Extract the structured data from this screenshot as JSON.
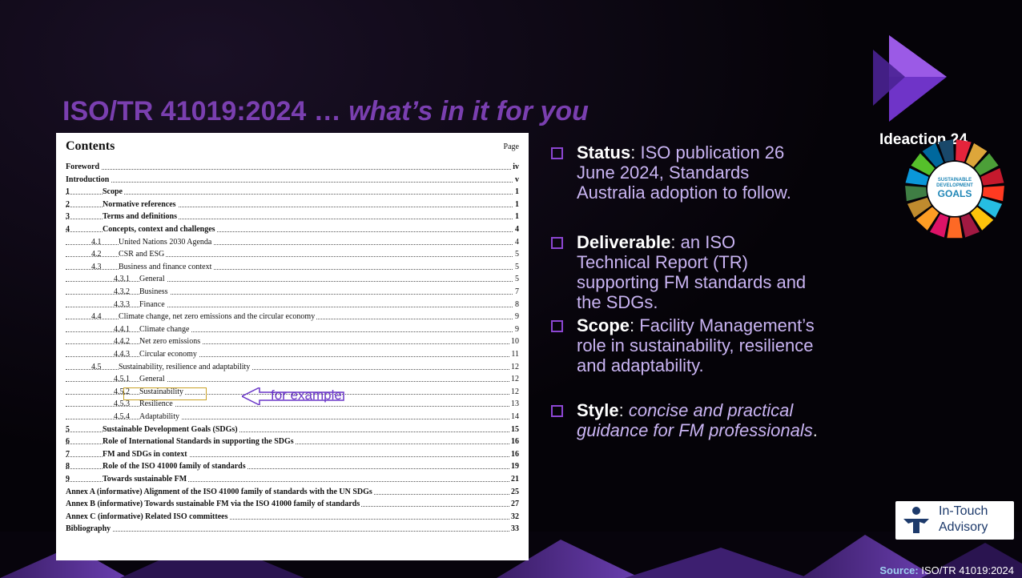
{
  "slide": {
    "title_main": "ISO/TR 41019:2024 … ",
    "title_sub": "what’s in it for you",
    "brand": "Ideaction.24"
  },
  "contents": {
    "title": "Contents",
    "page_header": "Page",
    "entries": [
      {
        "num": "",
        "label": "Foreword",
        "page": "iv",
        "bold": true,
        "level": 0
      },
      {
        "num": "",
        "label": "Introduction",
        "page": "v",
        "bold": true,
        "level": 0
      },
      {
        "num": "1",
        "label": "Scope",
        "page": "1",
        "bold": true,
        "level": 0
      },
      {
        "num": "2",
        "label": "Normative references",
        "page": "1",
        "bold": true,
        "level": 0
      },
      {
        "num": "3",
        "label": "Terms and definitions",
        "page": "1",
        "bold": true,
        "level": 0
      },
      {
        "num": "4",
        "label": "Concepts, context and challenges",
        "page": "4",
        "bold": true,
        "level": 0
      },
      {
        "num": "4.1",
        "label": "United Nations 2030 Agenda",
        "page": "4",
        "bold": false,
        "level": 1
      },
      {
        "num": "4.2",
        "label": "CSR and ESG",
        "page": "5",
        "bold": false,
        "level": 1
      },
      {
        "num": "4.3",
        "label": "Business and finance context",
        "page": "5",
        "bold": false,
        "level": 1
      },
      {
        "num": "4.3.1",
        "label": "General",
        "page": "5",
        "bold": false,
        "level": 2
      },
      {
        "num": "4.3.2",
        "label": "Business",
        "page": "7",
        "bold": false,
        "level": 2
      },
      {
        "num": "4.3.3",
        "label": "Finance",
        "page": "8",
        "bold": false,
        "level": 2
      },
      {
        "num": "4.4",
        "label": "Climate change, net zero emissions and the circular economy",
        "page": "9",
        "bold": false,
        "level": 1
      },
      {
        "num": "4.4.1",
        "label": "Climate change",
        "page": "9",
        "bold": false,
        "level": 2
      },
      {
        "num": "4.4.2",
        "label": "Net zero emissions",
        "page": "10",
        "bold": false,
        "level": 2
      },
      {
        "num": "4.4.3",
        "label": "Circular economy",
        "page": "11",
        "bold": false,
        "level": 2
      },
      {
        "num": "4.5",
        "label": "Sustainability, resilience and adaptability",
        "page": "12",
        "bold": false,
        "level": 1
      },
      {
        "num": "4.5.1",
        "label": "General",
        "page": "12",
        "bold": false,
        "level": 2
      },
      {
        "num": "4.5.2",
        "label": "Sustainability",
        "page": "12",
        "bold": false,
        "level": 2
      },
      {
        "num": "4.5.3",
        "label": "Resilience",
        "page": "13",
        "bold": false,
        "level": 2
      },
      {
        "num": "4.5.4",
        "label": "Adaptability",
        "page": "14",
        "bold": false,
        "level": 2
      },
      {
        "num": "5",
        "label": "Sustainable Development Goals (SDGs)",
        "page": "15",
        "bold": true,
        "level": 0
      },
      {
        "num": "6",
        "label": "Role of International Standards in supporting the SDGs",
        "page": "16",
        "bold": true,
        "level": 0
      },
      {
        "num": "7",
        "label": "FM and SDGs in context",
        "page": "16",
        "bold": true,
        "level": 0
      },
      {
        "num": "8",
        "label": "Role of the ISO 41000 family of standards",
        "page": "19",
        "bold": true,
        "level": 0
      },
      {
        "num": "9",
        "label": "Towards sustainable FM",
        "page": "21",
        "bold": true,
        "level": 0
      },
      {
        "num": "",
        "label": "Annex A (informative) Alignment of the ISO 41000 family of standards with the UN SDGs",
        "page": "25",
        "bold": true,
        "level": 0
      },
      {
        "num": "",
        "label": "Annex B (informative) Towards sustainable FM via the ISO 41000 family of standards",
        "page": "27",
        "bold": true,
        "level": 0
      },
      {
        "num": "",
        "label": "Annex C (informative) Related ISO committees",
        "page": "32",
        "bold": true,
        "level": 0
      },
      {
        "num": "",
        "label": "Bibliography",
        "page": "33",
        "bold": true,
        "level": 0
      }
    ],
    "callout": "for example"
  },
  "bullets": [
    {
      "key": "Status",
      "sep": ": ",
      "text": "ISO publication 26 June 2024, Standards Australia adoption to follow.",
      "italic": false
    },
    {
      "key": "Deliverable",
      "sep": ": ",
      "text": "an ISO Technical Report (TR) supporting FM standards and the SDGs.",
      "italic": false
    },
    {
      "key": "Scope",
      "sep": ": ",
      "text": "Facility Management’s role in sustainability, resilience and adaptability.",
      "italic": false
    },
    {
      "key": "Style",
      "sep": ": ",
      "text": "concise and practical guidance for FM professionals",
      "tail": ".",
      "italic": true
    }
  ],
  "sdg_logo": {
    "line1": "SUSTAINABLE",
    "line2": "DEVELOPMENT",
    "line3": "GOALS"
  },
  "intouch": {
    "line1": "In-Touch",
    "line2": "Advisory"
  },
  "source": {
    "label": "Source:",
    "value": " ISO/TR 41019:2024"
  },
  "colors": {
    "title": "#7a3fb0",
    "bullet_box": "#8c46d2",
    "bullet_text": "#c9b4f2",
    "callout": "#6a37c7",
    "highlight": "#c9a227"
  }
}
